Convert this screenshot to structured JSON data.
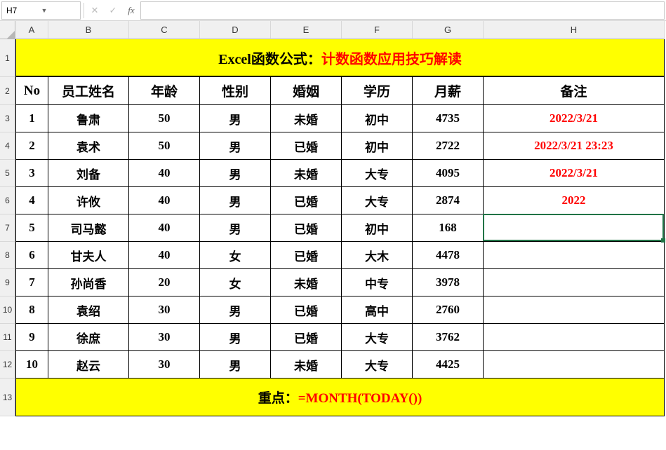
{
  "name_box": "H7",
  "columns": [
    "A",
    "B",
    "C",
    "D",
    "E",
    "F",
    "G",
    "H"
  ],
  "row_nums": [
    "1",
    "2",
    "3",
    "4",
    "5",
    "6",
    "7",
    "8",
    "9",
    "10",
    "11",
    "12",
    "13"
  ],
  "title_prefix": "Excel函数公式：",
  "title_suffix": "计数函数应用技巧解读",
  "headers": {
    "no": "No",
    "name": "员工姓名",
    "age": "年龄",
    "sex": "性别",
    "marriage": "婚姻",
    "edu": "学历",
    "salary": "月薪",
    "remark": "备注"
  },
  "rows": [
    {
      "no": "1",
      "name": "鲁肃",
      "age": "50",
      "sex": "男",
      "marriage": "未婚",
      "edu": "初中",
      "salary": "4735",
      "remark": "2022/3/21"
    },
    {
      "no": "2",
      "name": "袁术",
      "age": "50",
      "sex": "男",
      "marriage": "已婚",
      "edu": "初中",
      "salary": "2722",
      "remark": "2022/3/21 23:23"
    },
    {
      "no": "3",
      "name": "刘备",
      "age": "40",
      "sex": "男",
      "marriage": "未婚",
      "edu": "大专",
      "salary": "4095",
      "remark": "2022/3/21"
    },
    {
      "no": "4",
      "name": "许攸",
      "age": "40",
      "sex": "男",
      "marriage": "已婚",
      "edu": "大专",
      "salary": "2874",
      "remark": "2022"
    },
    {
      "no": "5",
      "name": "司马懿",
      "age": "40",
      "sex": "男",
      "marriage": "已婚",
      "edu": "初中",
      "salary": "168",
      "remark": ""
    },
    {
      "no": "6",
      "name": "甘夫人",
      "age": "40",
      "sex": "女",
      "marriage": "已婚",
      "edu": "大木",
      "salary": "4478",
      "remark": ""
    },
    {
      "no": "7",
      "name": "孙尚香",
      "age": "20",
      "sex": "女",
      "marriage": "未婚",
      "edu": "中专",
      "salary": "3978",
      "remark": ""
    },
    {
      "no": "8",
      "name": "袁绍",
      "age": "30",
      "sex": "男",
      "marriage": "已婚",
      "edu": "高中",
      "salary": "2760",
      "remark": ""
    },
    {
      "no": "9",
      "name": "徐庶",
      "age": "30",
      "sex": "男",
      "marriage": "已婚",
      "edu": "大专",
      "salary": "3762",
      "remark": ""
    },
    {
      "no": "10",
      "name": "赵云",
      "age": "30",
      "sex": "男",
      "marriage": "未婚",
      "edu": "大专",
      "salary": "4425",
      "remark": ""
    }
  ],
  "footer_prefix": "重点：",
  "footer_suffix": "=MONTH(TODAY())",
  "row_heights": {
    "title": 54,
    "header": 40,
    "data": 39,
    "footer": 54
  }
}
